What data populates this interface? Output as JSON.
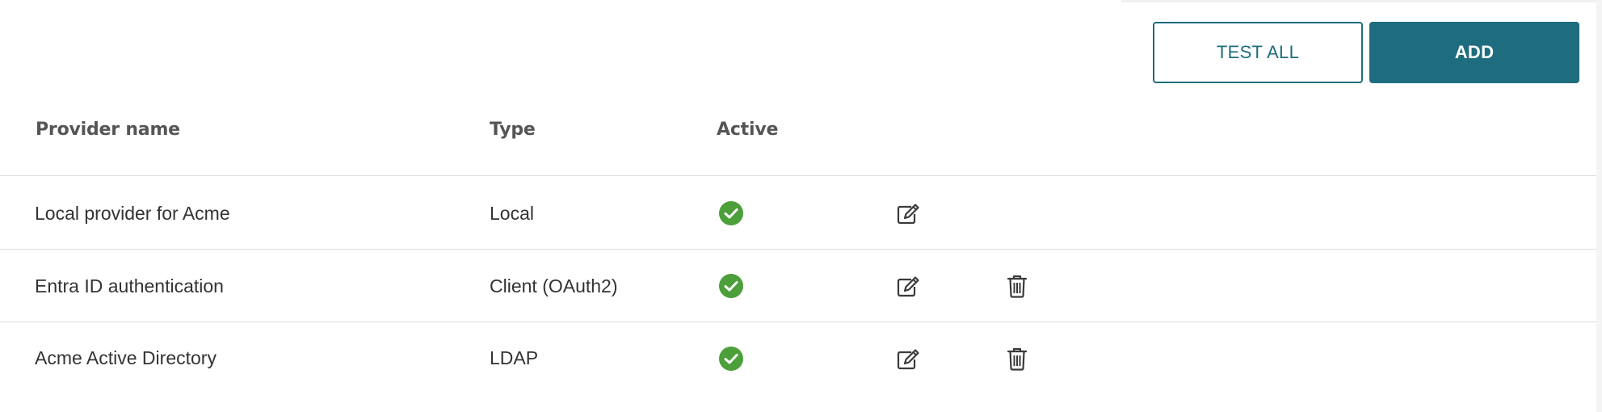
{
  "toolbar": {
    "test_all_label": "TEST ALL",
    "add_label": "ADD"
  },
  "table": {
    "columns": [
      "Provider name",
      "Type",
      "Active"
    ],
    "rows": [
      {
        "name": "Local provider for Acme",
        "type": "Local",
        "active": true,
        "actions": [
          "edit-icon"
        ]
      },
      {
        "name": "Entra ID authentication",
        "type": "Client (OAuth2)",
        "active": true,
        "actions": [
          "edit-icon",
          "trash-icon"
        ]
      },
      {
        "name": "Acme Active Directory",
        "type": "LDAP",
        "active": true,
        "actions": [
          "edit-icon",
          "trash-icon"
        ]
      }
    ]
  },
  "colors": {
    "accent": "#1e6d7e",
    "active_check": "#4c9f3a",
    "header_text": "#555555",
    "divider": "#dcdcdc"
  },
  "icons": {
    "active": "check-circle-icon",
    "edit": "edit-icon",
    "delete": "trash-icon"
  }
}
